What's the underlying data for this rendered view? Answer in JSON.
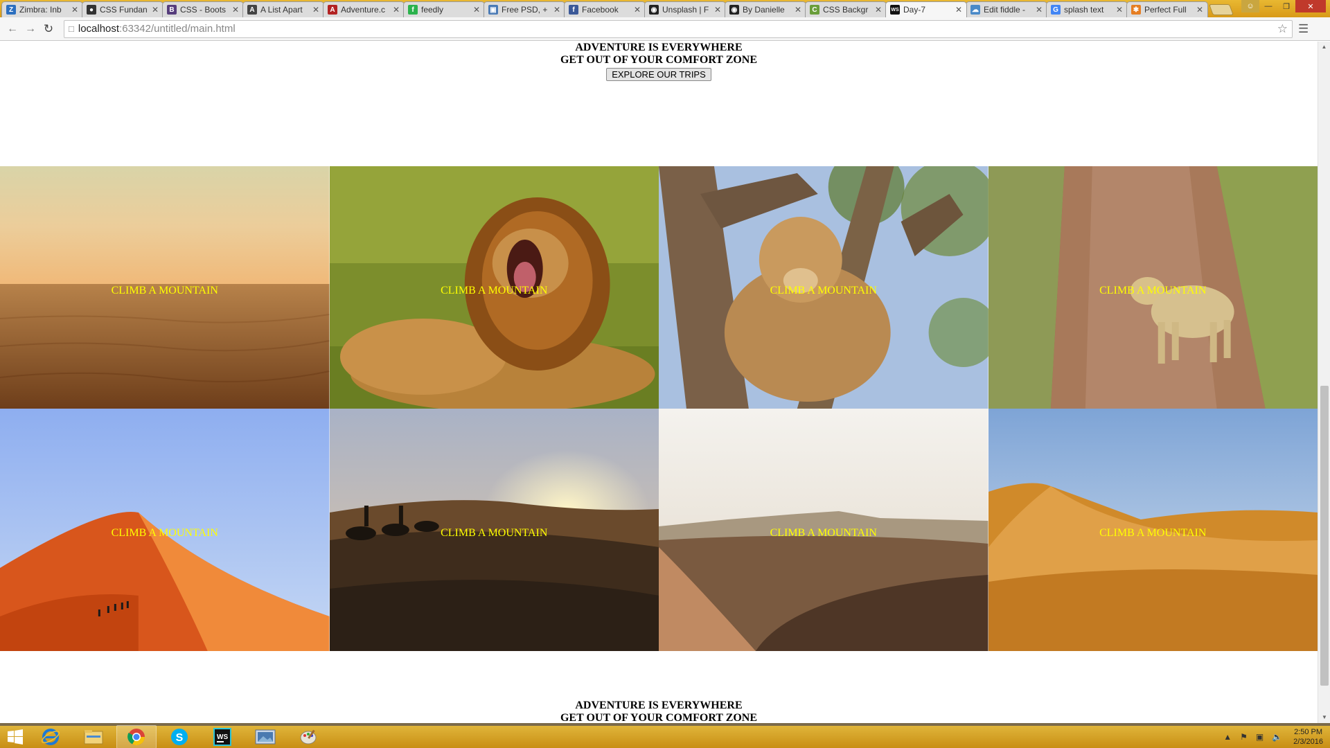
{
  "browser": {
    "tabs": [
      {
        "label": "Zimbra: Inb",
        "favicon": "zimbra-icon",
        "color": "#2c6fbf",
        "glyph": "Z"
      },
      {
        "label": "CSS Fundan",
        "favicon": "github-icon",
        "color": "#333333",
        "glyph": "●"
      },
      {
        "label": "CSS - Boots",
        "favicon": "bootstrap-icon",
        "color": "#563d7c",
        "glyph": "B"
      },
      {
        "label": "A List Apart",
        "favicon": "alistapart-icon",
        "color": "#444444",
        "glyph": "A"
      },
      {
        "label": "Adventure.c",
        "favicon": "adventure-icon",
        "color": "#b22222",
        "glyph": "A"
      },
      {
        "label": "feedly",
        "favicon": "feedly-icon",
        "color": "#2bb24c",
        "glyph": "f"
      },
      {
        "label": "Free PSD, +",
        "favicon": "image-icon",
        "color": "#4a7ab5",
        "glyph": "▣"
      },
      {
        "label": "Facebook",
        "favicon": "facebook-icon",
        "color": "#3b5998",
        "glyph": "f"
      },
      {
        "label": "Unsplash | F",
        "favicon": "camera-icon",
        "color": "#222222",
        "glyph": "◉"
      },
      {
        "label": "By Danielle",
        "favicon": "camera-icon",
        "color": "#222222",
        "glyph": "◉"
      },
      {
        "label": "CSS Backgr",
        "favicon": "css-icon",
        "color": "#6a9e3a",
        "glyph": "C"
      },
      {
        "label": "Day-7",
        "favicon": "webstorm-icon",
        "color": "#111111",
        "glyph": "WS",
        "active": true
      },
      {
        "label": "Edit fiddle -",
        "favicon": "jsfiddle-icon",
        "color": "#4a8ac8",
        "glyph": "☁"
      },
      {
        "label": "splash text",
        "favicon": "google-icon",
        "color": "#4285f4",
        "glyph": "G"
      },
      {
        "label": "Perfect Full",
        "favicon": "star-icon",
        "color": "#e67e22",
        "glyph": "✱"
      }
    ],
    "url": {
      "host": "localhost",
      "port": ":63342",
      "path": "/untitled/main.html"
    }
  },
  "page": {
    "hero_top": {
      "line1": "ADVENTURE IS EVERYWHERE",
      "line2": "GET OUT OF YOUR COMFORT ZONE",
      "button": "EXPLORE OUR TRIPS"
    },
    "tiles": [
      {
        "caption": "CLIMB A MOUNTAIN",
        "scene": "desert-dusk"
      },
      {
        "caption": "CLIMB A MOUNTAIN",
        "scene": "roaring-lion"
      },
      {
        "caption": "CLIMB A MOUNTAIN",
        "scene": "lioness-in-tree"
      },
      {
        "caption": "CLIMB A MOUNTAIN",
        "scene": "leopard-on-road"
      },
      {
        "caption": "CLIMB A MOUNTAIN",
        "scene": "red-dune-climbers"
      },
      {
        "caption": "CLIMB A MOUNTAIN",
        "scene": "camel-caravan-sunset"
      },
      {
        "caption": "CLIMB A MOUNTAIN",
        "scene": "hazy-dunes"
      },
      {
        "caption": "CLIMB A MOUNTAIN",
        "scene": "golden-dune"
      }
    ],
    "hero_bottom": {
      "line1": "ADVENTURE IS EVERYWHERE",
      "line2": "GET OUT OF YOUR COMFORT ZONE"
    }
  },
  "taskbar": {
    "apps": [
      "internet-explorer-icon",
      "file-explorer-icon",
      "chrome-icon",
      "skype-icon",
      "webstorm-icon",
      "photos-icon",
      "paint-icon"
    ],
    "clock": {
      "time": "2:50 PM",
      "date": "2/3/2016"
    }
  },
  "colors": {
    "caption": "#ffff00",
    "taskbar": "#d9a52a"
  }
}
